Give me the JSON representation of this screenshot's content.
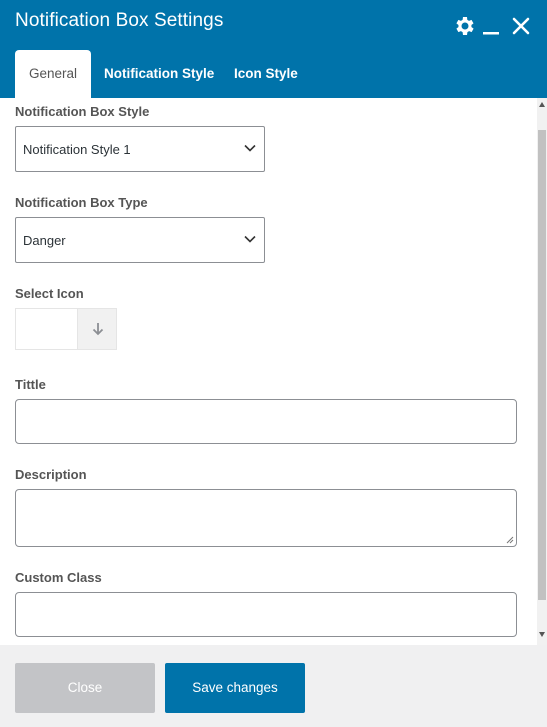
{
  "dialog": {
    "title": "Notification Box Settings",
    "tabs": [
      "General",
      "Notification Style",
      "Icon Style"
    ],
    "active_tab": "General"
  },
  "fields": {
    "box_style": {
      "label": "Notification Box Style",
      "value": "Notification Style 1"
    },
    "box_type": {
      "label": "Notification Box Type",
      "value": "Danger"
    },
    "icon": {
      "label": "Select Icon"
    },
    "title": {
      "label": "Tittle",
      "value": ""
    },
    "description": {
      "label": "Description",
      "value": ""
    },
    "custom_class": {
      "label": "Custom Class",
      "value": ""
    }
  },
  "footer": {
    "close_label": "Close",
    "save_label": "Save changes"
  },
  "colors": {
    "accent": "#0073aa",
    "disabled_button": "#c3c4c7",
    "footer_bg": "#f0f0f1"
  },
  "icons": [
    "gear-icon",
    "minimize-icon",
    "close-icon",
    "chevron-down-icon",
    "arrow-down-icon"
  ]
}
